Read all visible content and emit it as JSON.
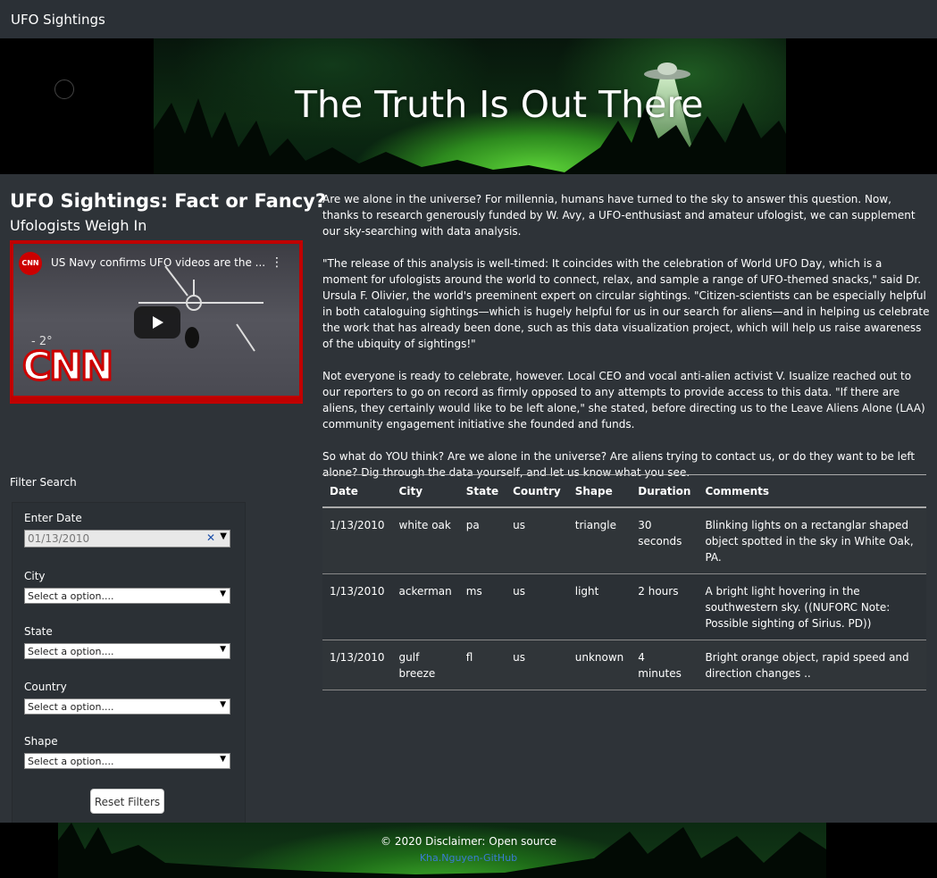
{
  "navbar": {
    "brand": "UFO Sightings"
  },
  "hero": {
    "title": "The Truth Is Out There"
  },
  "intro": {
    "heading": "UFO Sightings: Fact or Fancy?",
    "subheading": "Ufologists Weigh In"
  },
  "video": {
    "title": "US Navy confirms UFO videos are the ...",
    "channel_logo": "CNN",
    "overlay_logo": "CNN",
    "overlay_temp": "- 2°"
  },
  "article": {
    "paragraphs": [
      "Are we alone in the universe? For millennia, humans have turned to the sky to answer this question. Now, thanks to research generously funded by W. Avy, a UFO-enthusiast and amateur ufologist, we can supplement our sky-searching with data analysis.",
      "\"The release of this analysis is well-timed: It coincides with the celebration of World UFO Day, which is a moment for ufologists around the world to connect, relax, and sample a range of UFO-themed snacks,\" said Dr. Ursula F. Olivier, the world's preeminent expert on circular sightings. \"Citizen-scientists can be especially helpful in both cataloguing sightings—which is hugely helpful for us in our search for aliens—and in helping us celebrate the work that has already been done, such as this data visualization project, which will help us raise awareness of the ubiquity of sightings!\"",
      "Not everyone is ready to celebrate, however. Local CEO and vocal anti-alien activist V. Isualize reached out to our reporters to go on record as firmly opposed to any attempts to provide access to this data. \"If there are aliens, they certainly would like to be left alone,\" she stated, before directing us to the Leave Aliens Alone (LAA) community engagement initiative she founded and funds.",
      "So what do YOU think? Are we alone in the universe? Are aliens trying to contact us, or do they want to be left alone? Dig through the data yourself, and let us know what you see."
    ]
  },
  "filters": {
    "section_label": "Filter Search",
    "date_label": "Enter Date",
    "date_value": "01/13/2010",
    "city_label": "City",
    "state_label": "State",
    "country_label": "Country",
    "shape_label": "Shape",
    "select_placeholder": "Select a option....",
    "reset_label": "Reset Filters"
  },
  "table": {
    "headers": [
      "Date",
      "City",
      "State",
      "Country",
      "Shape",
      "Duration",
      "Comments"
    ],
    "rows": [
      [
        "1/13/2010",
        "white oak",
        "pa",
        "us",
        "triangle",
        "30 seconds",
        "Blinking lights on a rectanglar shaped object spotted in the sky in White Oak, PA."
      ],
      [
        "1/13/2010",
        "ackerman",
        "ms",
        "us",
        "light",
        "2 hours",
        "A bright light hovering in the southwestern sky. ((NUFORC Note: Possible sighting of Sirius. PD))"
      ],
      [
        "1/13/2010",
        "gulf breeze",
        "fl",
        "us",
        "unknown",
        "4 minutes",
        "Bright orange object, rapid speed and direction changes .."
      ]
    ]
  },
  "footer": {
    "copyright": "© 2020 Disclaimer: Open source",
    "link": "Kha.Nguyen-GitHub"
  }
}
